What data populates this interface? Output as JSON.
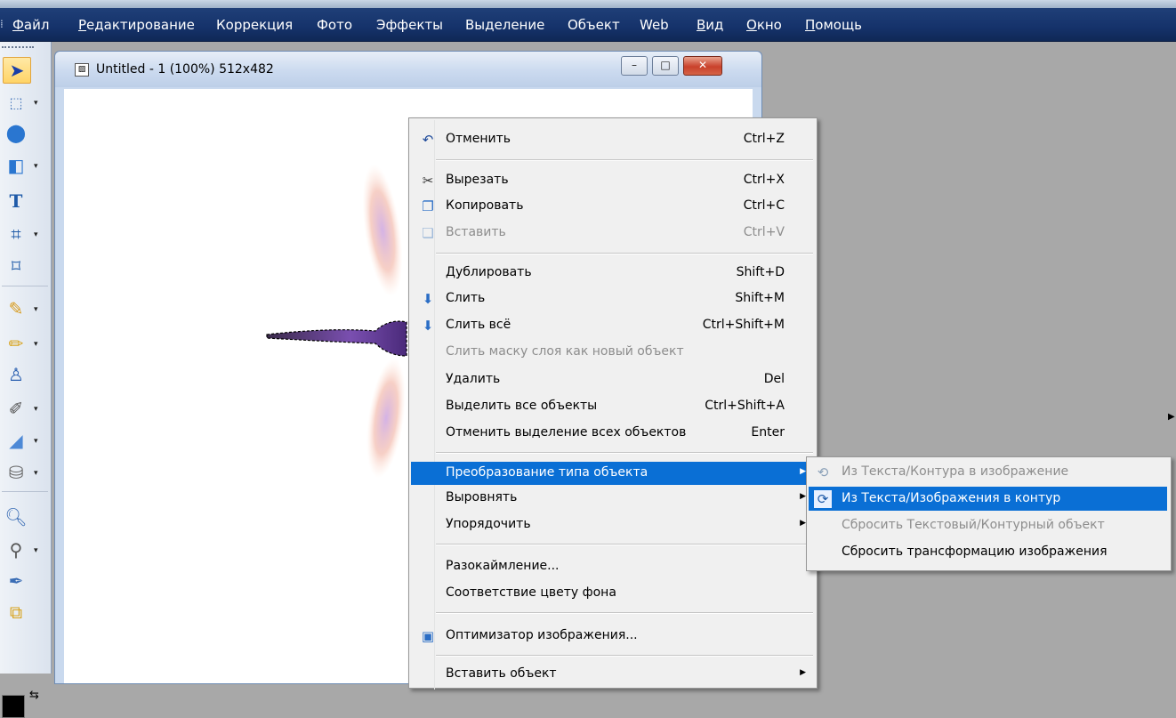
{
  "menubar": {
    "items": [
      "Файл",
      "Редактирование",
      "Коррекция",
      "Фото",
      "Эффекты",
      "Выделение",
      "Объект",
      "Web",
      "Вид",
      "Окно",
      "Помощь"
    ]
  },
  "document": {
    "title": "Untitled - 1 (100%) 512x482",
    "minimize": "–",
    "maximize": "□",
    "close": "✕"
  },
  "context_menu": {
    "items": [
      {
        "label": "Отменить",
        "shortcut": "Ctrl+Z",
        "icon": "undo-icon",
        "glyph": "↶"
      },
      {
        "label": "Вырезать",
        "shortcut": "Ctrl+X",
        "icon": "scissors-icon",
        "glyph": "✂"
      },
      {
        "label": "Копировать",
        "shortcut": "Ctrl+C",
        "icon": "copy-icon",
        "glyph": "❐"
      },
      {
        "label": "Вставить",
        "shortcut": "Ctrl+V",
        "icon": "paste-icon",
        "glyph": "❏"
      },
      {
        "label": "Дублировать",
        "shortcut": "Shift+D"
      },
      {
        "label": "Слить",
        "shortcut": "Shift+M",
        "icon": "merge-icon",
        "glyph": "⬇"
      },
      {
        "label": "Слить всё",
        "shortcut": "Ctrl+Shift+M",
        "icon": "merge-all-icon",
        "glyph": "⬇"
      },
      {
        "label": "Слить маску слоя как новый объект"
      },
      {
        "label": "Удалить",
        "shortcut": "Del"
      },
      {
        "label": "Выделить все объекты",
        "shortcut": "Ctrl+Shift+A"
      },
      {
        "label": "Отменить выделение всех объектов",
        "shortcut": "Enter"
      },
      {
        "label": "Преобразование типа объекта"
      },
      {
        "label": "Выровнять"
      },
      {
        "label": "Упорядочить"
      },
      {
        "label": "Разокаймление..."
      },
      {
        "label": "Соответствие цвету фона"
      },
      {
        "label": "Оптимизатор изображения...",
        "icon": "optimizer-icon",
        "glyph": "▣"
      },
      {
        "label": "Вставить объект"
      }
    ],
    "submenu_arrow": "▶"
  },
  "submenu": {
    "items": [
      {
        "label": "Из Текста/Контура в изображение",
        "icon": "text-to-image-icon",
        "glyph": "⟲"
      },
      {
        "label": "Из Текста/Изображения в контур",
        "icon": "image-to-path-icon",
        "glyph": "⟳"
      },
      {
        "label": "Сбросить Текстовый/Контурный объект"
      },
      {
        "label": "Сбросить трансформацию изображения"
      }
    ]
  },
  "colors": {
    "menubar": "#15326a",
    "highlight": "#0a6fd5",
    "desktop": "#a8a8a8"
  }
}
